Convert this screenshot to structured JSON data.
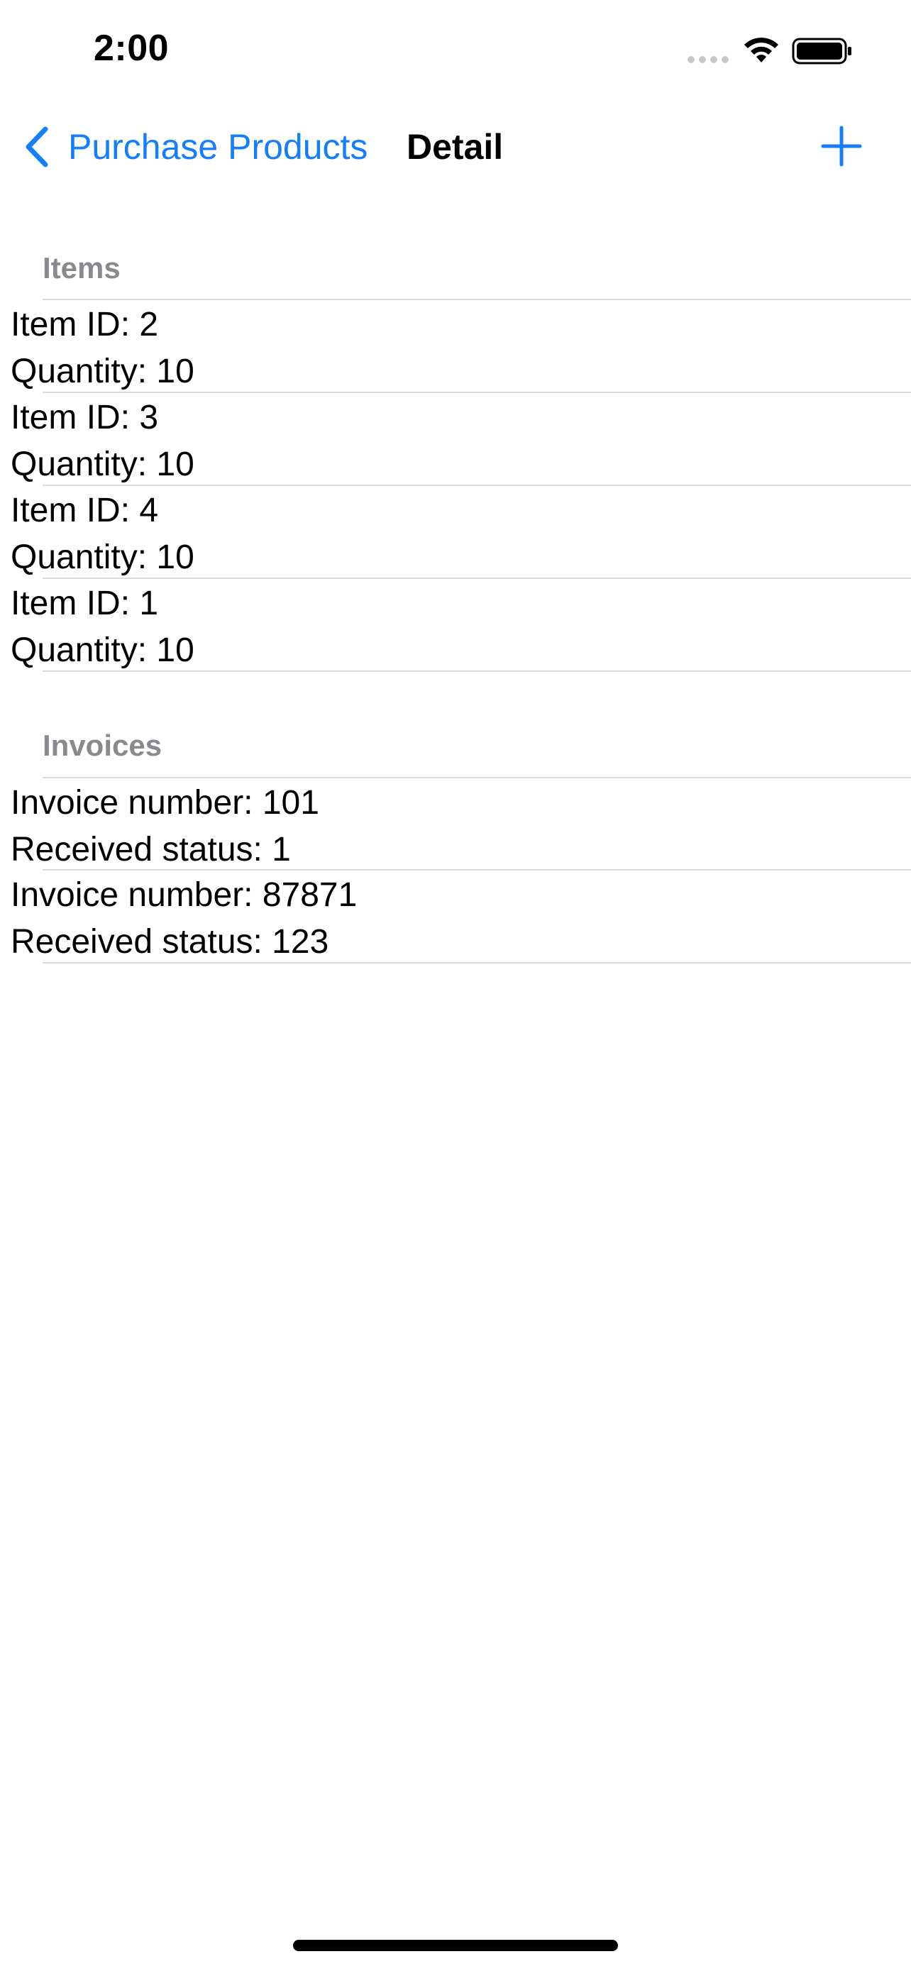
{
  "status_bar": {
    "time": "2:00",
    "icons": [
      "signal-icon",
      "wifi-icon",
      "battery-icon"
    ]
  },
  "nav": {
    "back_label": "Purchase Products",
    "title": "Detail",
    "back_icon": "chevron-left-icon",
    "add_icon": "plus-icon",
    "accent_color": "#147EFB"
  },
  "items_section": {
    "header": "Items",
    "rows": [
      {
        "line1": "Item ID: 2",
        "line2": "Quantity: 10"
      },
      {
        "line1": "Item ID: 3",
        "line2": "Quantity: 10"
      },
      {
        "line1": "Item ID: 4",
        "line2": "Quantity: 10"
      },
      {
        "line1": "Item ID: 1",
        "line2": "Quantity: 10"
      }
    ]
  },
  "invoices_section": {
    "header": "Invoices",
    "rows": [
      {
        "line1": "Invoice number: 101",
        "line2": "Received status: 1"
      },
      {
        "line1": "Invoice number: 87871",
        "line2": "Received status: 123"
      }
    ]
  }
}
